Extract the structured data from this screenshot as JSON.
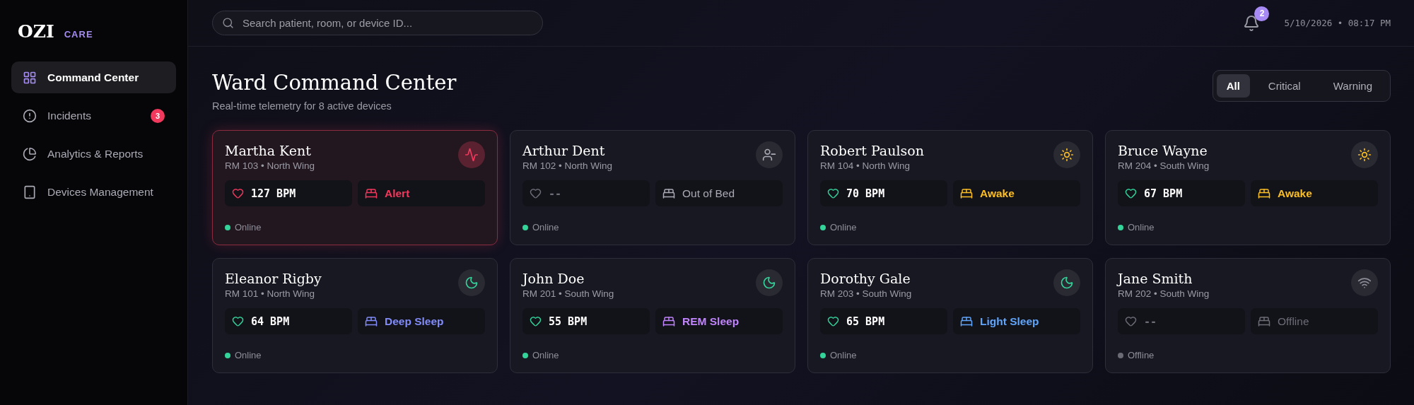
{
  "brand": {
    "name": "OZI",
    "tag": "CARE"
  },
  "nav": [
    {
      "label": "Command Center",
      "selected": true
    },
    {
      "label": "Incidents",
      "selected": false,
      "badge": "3"
    },
    {
      "label": "Analytics & Reports",
      "selected": false
    },
    {
      "label": "Devices Management",
      "selected": false
    }
  ],
  "search": {
    "placeholder": "Search patient, room, or device ID..."
  },
  "notifications": {
    "count": "2"
  },
  "datetime": "5/10/2026 • 08:17 PM",
  "header": {
    "title": "Ward Command Center",
    "subtitle": "Real-time telemetry for 8 active devices"
  },
  "filters": [
    {
      "label": "All",
      "selected": true
    },
    {
      "label": "Critical",
      "selected": false
    },
    {
      "label": "Warning",
      "selected": false
    }
  ],
  "patients": [
    {
      "kind": "alert",
      "name": "Martha Kent",
      "room": "RM 103 • North Wing",
      "bpm": "127 BPM",
      "state": "Alert",
      "online": true,
      "connection": "Online"
    },
    {
      "kind": "absent",
      "name": "Arthur Dent",
      "room": "RM 102 • North Wing",
      "bpm": "--",
      "state": "Out of Bed",
      "online": true,
      "connection": "Online"
    },
    {
      "kind": "awake",
      "name": "Robert Paulson",
      "room": "RM 104 • North Wing",
      "bpm": "70 BPM",
      "state": "Awake",
      "online": true,
      "connection": "Online"
    },
    {
      "kind": "awake",
      "name": "Bruce Wayne",
      "room": "RM 204 • South Wing",
      "bpm": "67 BPM",
      "state": "Awake",
      "online": true,
      "connection": "Online"
    },
    {
      "kind": "deep",
      "name": "Eleanor Rigby",
      "room": "RM 101 • North Wing",
      "bpm": "64 BPM",
      "state": "Deep Sleep",
      "online": true,
      "connection": "Online"
    },
    {
      "kind": "rem",
      "name": "John Doe",
      "room": "RM 201 • South Wing",
      "bpm": "55 BPM",
      "state": "REM Sleep",
      "online": true,
      "connection": "Online"
    },
    {
      "kind": "light",
      "name": "Dorothy Gale",
      "room": "RM 203 • South Wing",
      "bpm": "65 BPM",
      "state": "Light Sleep",
      "online": true,
      "connection": "Online"
    },
    {
      "kind": "offline",
      "name": "Jane Smith",
      "room": "RM 202 • South Wing",
      "bpm": "--",
      "state": "Offline",
      "online": false,
      "connection": "Offline"
    }
  ]
}
